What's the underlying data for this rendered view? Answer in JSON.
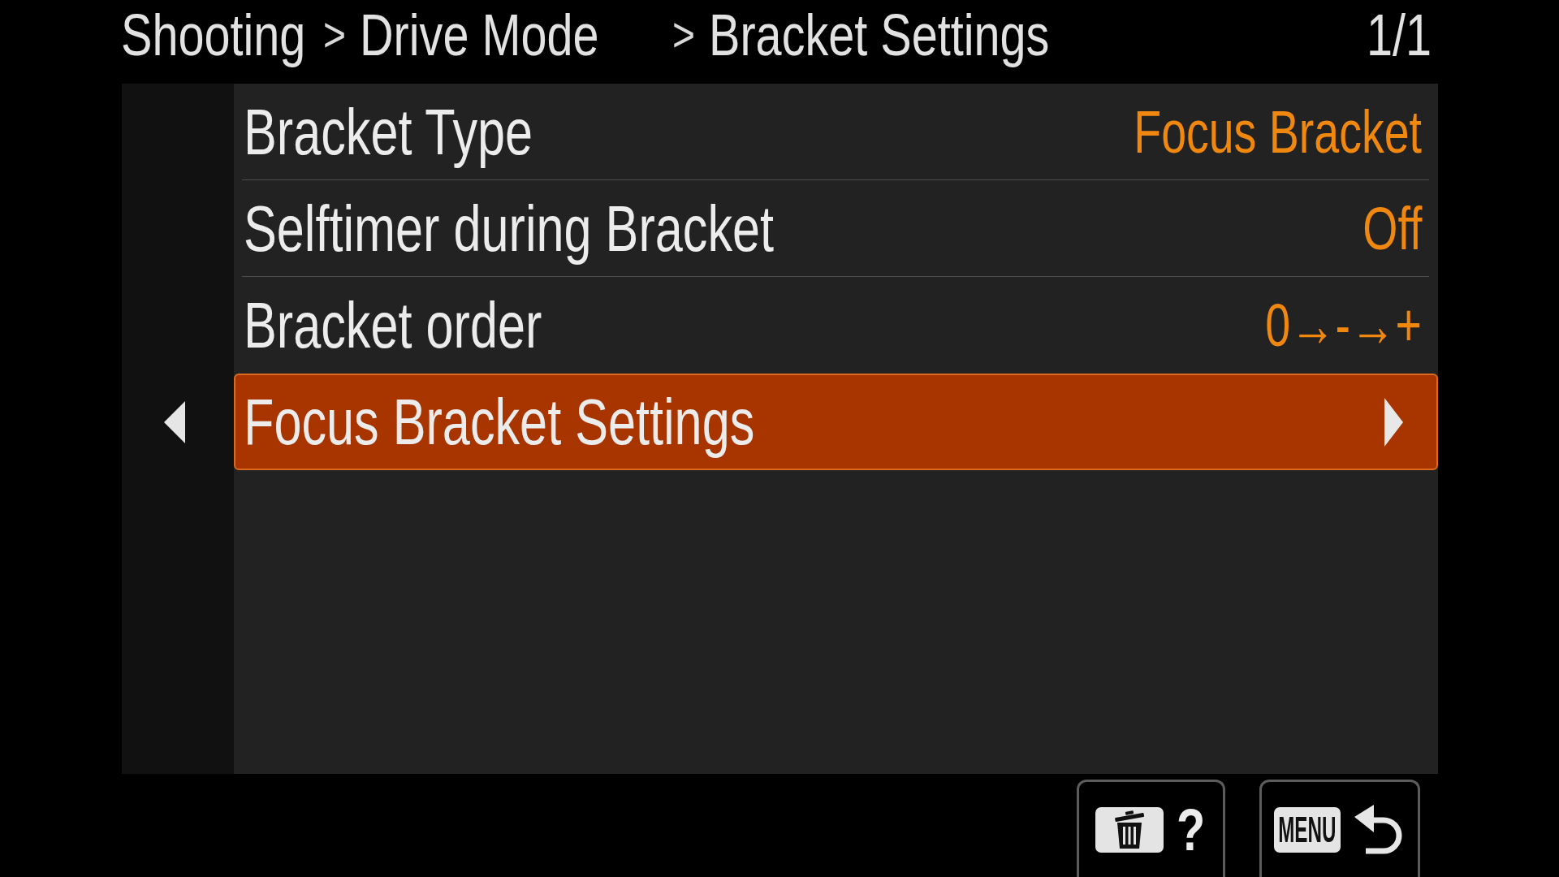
{
  "header": {
    "breadcrumb": [
      {
        "label": "Shooting"
      },
      {
        "separator": ">",
        "label": "Drive Mode"
      },
      {
        "separator": ">",
        "label": "Bracket Settings"
      }
    ],
    "page": "1/1"
  },
  "menu": {
    "items": [
      {
        "kind": "setting",
        "label": "Bracket Type",
        "value": "Focus Bracket",
        "selected": false
      },
      {
        "kind": "setting",
        "label": "Selftimer during Bracket",
        "value": "Off",
        "selected": false
      },
      {
        "kind": "setting",
        "label": "Bracket order",
        "value": "0→-→+",
        "selected": false
      },
      {
        "kind": "submenu",
        "label": "Focus Bracket Settings",
        "selected": true
      }
    ]
  },
  "footer": {
    "buttons": [
      {
        "kind": "help",
        "label": "?"
      },
      {
        "kind": "back",
        "key": "MENU"
      }
    ]
  }
}
